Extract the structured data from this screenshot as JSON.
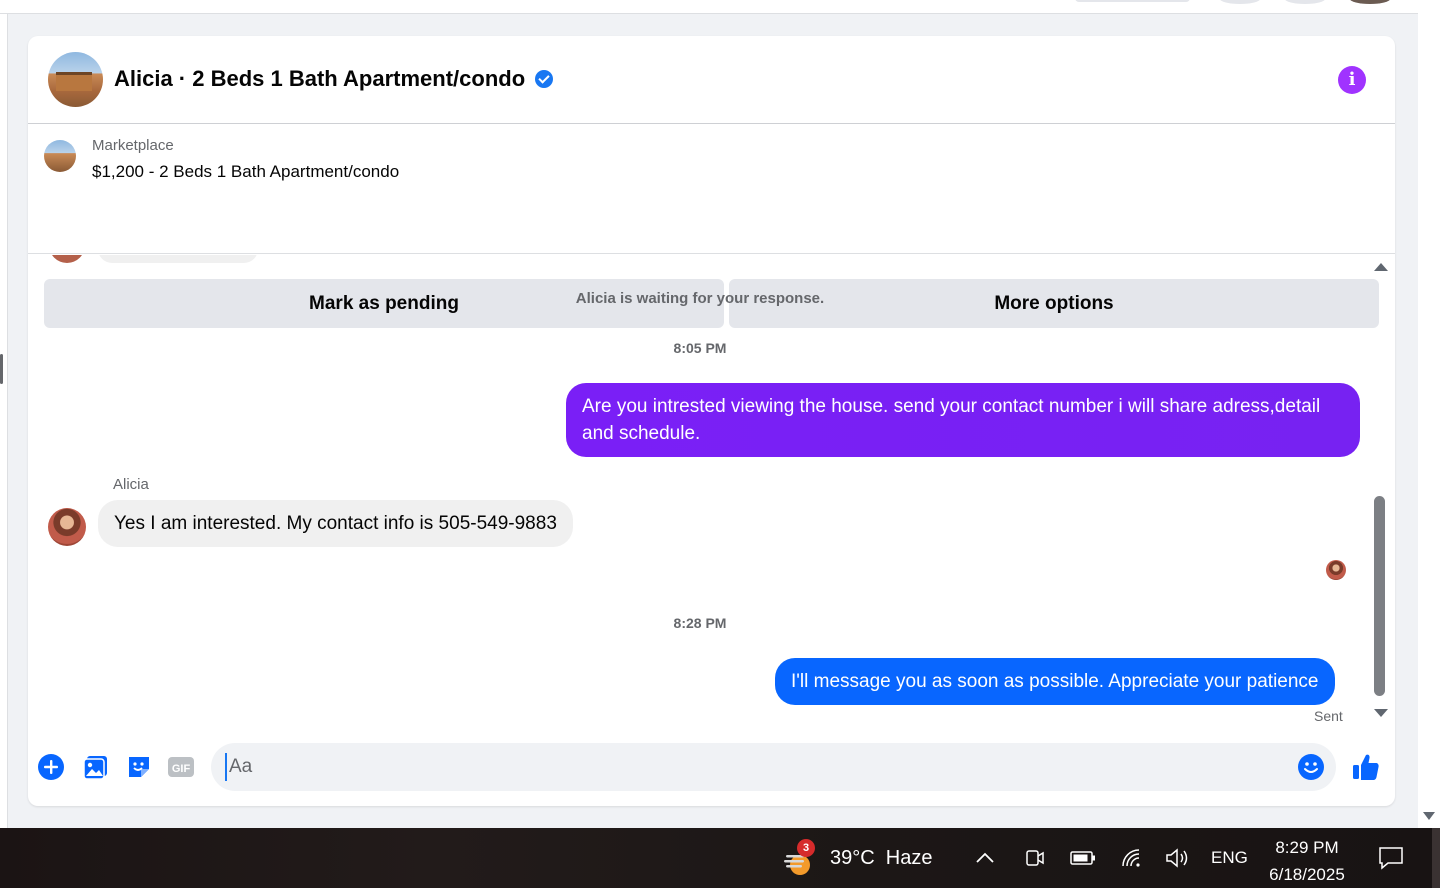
{
  "chat": {
    "title": "Alicia · 2 Beds 1 Bath Apartment/condo",
    "listing_source": "Marketplace",
    "listing_title": "$1,200 - 2 Beds 1 Bath Apartment/condo",
    "actions": {
      "mark_pending": "Mark as pending",
      "more_options": "More options"
    }
  },
  "messages": {
    "waiting_note": "Alicia is waiting for your response.",
    "timestamp_1": "8:05 PM",
    "outgoing_1": "Are you intrested viewing the house. send your contact number i will share adress,detail and schedule.",
    "sender_name": "Alicia",
    "incoming_1": "Yes I am interested. My contact info is 505-549-9883",
    "timestamp_2": "8:28 PM",
    "outgoing_2": "I'll message you as soon as possible. Appreciate your patience",
    "status": "Sent"
  },
  "composer": {
    "placeholder": "Aa"
  },
  "taskbar": {
    "weather_badge": "3",
    "weather": "39°C  Haze",
    "language": "ENG",
    "time": "8:29 PM",
    "date": "6/18/2025"
  },
  "colors": {
    "accent_blue": "#0866ff",
    "accent_purple": "#a033ff",
    "bubble_gradient_start": "#7a1ff6",
    "bubble_gradient_end": "#7722f2"
  }
}
